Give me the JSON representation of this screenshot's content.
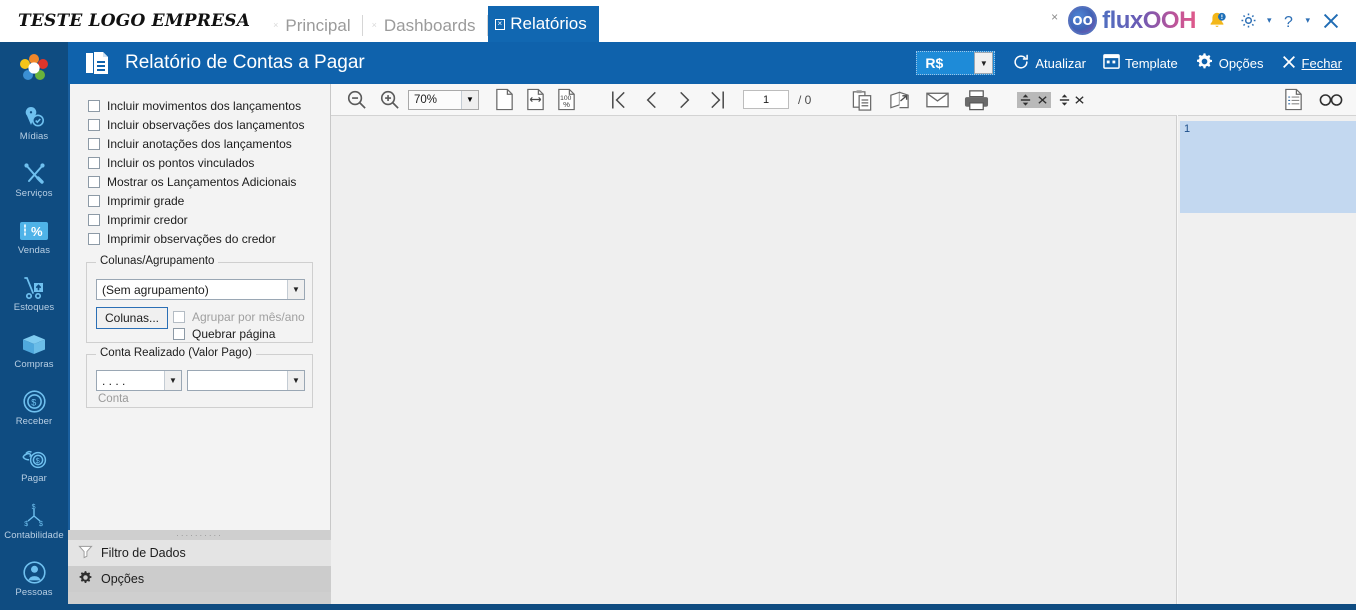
{
  "window": {
    "brand": "TESTE LOGO EMPRESA",
    "logo_text": "fluxOOH",
    "logo_mark": "OO"
  },
  "tabs": [
    {
      "label": "Principal",
      "active": false,
      "close_icon": "close-icon"
    },
    {
      "label": "Dashboards",
      "active": false,
      "close_icon": "close-icon"
    },
    {
      "label": "Relatórios",
      "active": true,
      "close_icon": "close-icon"
    }
  ],
  "header_actions": {
    "small_close": "×",
    "notifications_icon": "bell-icon",
    "settings_icon": "gear-icon",
    "help_icon": "help-icon",
    "close_icon": "close-icon",
    "caret": "▾"
  },
  "sidebar": {
    "logo_icon": "flower-logo-icon",
    "items": [
      {
        "label": "Mídias",
        "icon": "location-pin-check-icon"
      },
      {
        "label": "Serviços",
        "icon": "tools-icon"
      },
      {
        "label": "Vendas",
        "icon": "percent-tag-icon"
      },
      {
        "label": "Estoques",
        "icon": "hand-truck-icon"
      },
      {
        "label": "Compras",
        "icon": "box-icon"
      },
      {
        "label": "Receber",
        "icon": "coin-dollar-icon"
      },
      {
        "label": "Pagar",
        "icon": "hand-coin-icon"
      },
      {
        "label": "Contabilidade",
        "icon": "accounting-tree-icon"
      },
      {
        "label": "Pessoas",
        "icon": "person-icon"
      }
    ]
  },
  "command_bar": {
    "title": "Relatório de Contas a Pagar",
    "title_icon": "report-document-icon",
    "currency": {
      "value": "R$",
      "arrow": "▼"
    },
    "buttons": [
      {
        "label": "Atualizar",
        "icon": "refresh-icon"
      },
      {
        "label": "Template",
        "icon": "template-grid-icon"
      },
      {
        "label": "Opções",
        "icon": "gear-icon"
      },
      {
        "label": "Fechar",
        "icon": "close-icon",
        "accel": "F"
      }
    ]
  },
  "options_panel": {
    "checkboxes": [
      {
        "label": "Incluir movimentos dos lançamentos",
        "checked": false,
        "enabled": true
      },
      {
        "label": "Incluir observações dos lançamentos",
        "checked": false,
        "enabled": true
      },
      {
        "label": "Incluir anotações dos lançamentos",
        "checked": false,
        "enabled": true
      },
      {
        "label": "Incluir os pontos vinculados",
        "checked": false,
        "enabled": true
      },
      {
        "label": "Mostrar os Lançamentos Adicionais",
        "checked": false,
        "enabled": true
      },
      {
        "label": "Imprimir grade",
        "checked": false,
        "enabled": true
      },
      {
        "label": "Imprimir credor",
        "checked": false,
        "enabled": true
      },
      {
        "label": "Imprimir observações do credor",
        "checked": false,
        "enabled": true
      }
    ],
    "grouping": {
      "title": "Colunas/Agrupamento",
      "select_value": "(Sem agrupamento)",
      "select_arrow": "▼",
      "columns_button": "Colunas...",
      "checkbox_month_year": {
        "label": "Agrupar por mês/ano",
        "checked": false,
        "enabled": false
      },
      "checkbox_page_break": {
        "label": "Quebrar página",
        "checked": false,
        "enabled": true
      }
    },
    "account": {
      "title": "Conta Realizado (Valor Pago)",
      "code_value": ". . . .",
      "code_arrow": "▼",
      "name_value": "",
      "name_arrow": "▼",
      "hint": "Conta"
    }
  },
  "bottom_panels": [
    {
      "label": "Filtro de Dados",
      "icon": "funnel-icon",
      "selected": false
    },
    {
      "label": "Opções",
      "icon": "gear-icon",
      "selected": true
    }
  ],
  "report_toolbar": {
    "zoom_out_icon": "zoom-out-icon",
    "zoom_in_icon": "zoom-in-icon",
    "zoom_value": "70%",
    "zoom_arrow": "▼",
    "whole_page_icon": "whole-page-icon",
    "page_width_icon": "page-width-icon",
    "actual_size_icon": "actual-size-100-icon",
    "first_page_icon": "first-page-icon",
    "prev_page_icon": "prev-page-icon",
    "next_page_icon": "next-page-icon",
    "last_page_icon": "last-page-icon",
    "page_number": "1",
    "page_total": "/ 0",
    "copy_icon": "copy-clipboard-icon",
    "export_icon": "export-share-icon",
    "email_icon": "email-icon",
    "print_icon": "print-icon",
    "expand_icon": "expand-collapse-icon",
    "expand_close_icon": "close-small-icon",
    "expand_icon_2": "expand-collapse-icon",
    "expand_close_icon_2": "close-small-icon",
    "outline_icon": "outline-panel-icon",
    "search_icon": "binoculars-search-icon"
  },
  "thumbnail": {
    "page_label": "1"
  },
  "colors": {
    "brand_blue": "#0f4c81",
    "command_blue": "#0f62ac",
    "tab_active": "#1167b1",
    "panel_bg": "#f3f3f3",
    "preview_bg": "#efefef",
    "thumb_selected": "#c3d8f0"
  }
}
